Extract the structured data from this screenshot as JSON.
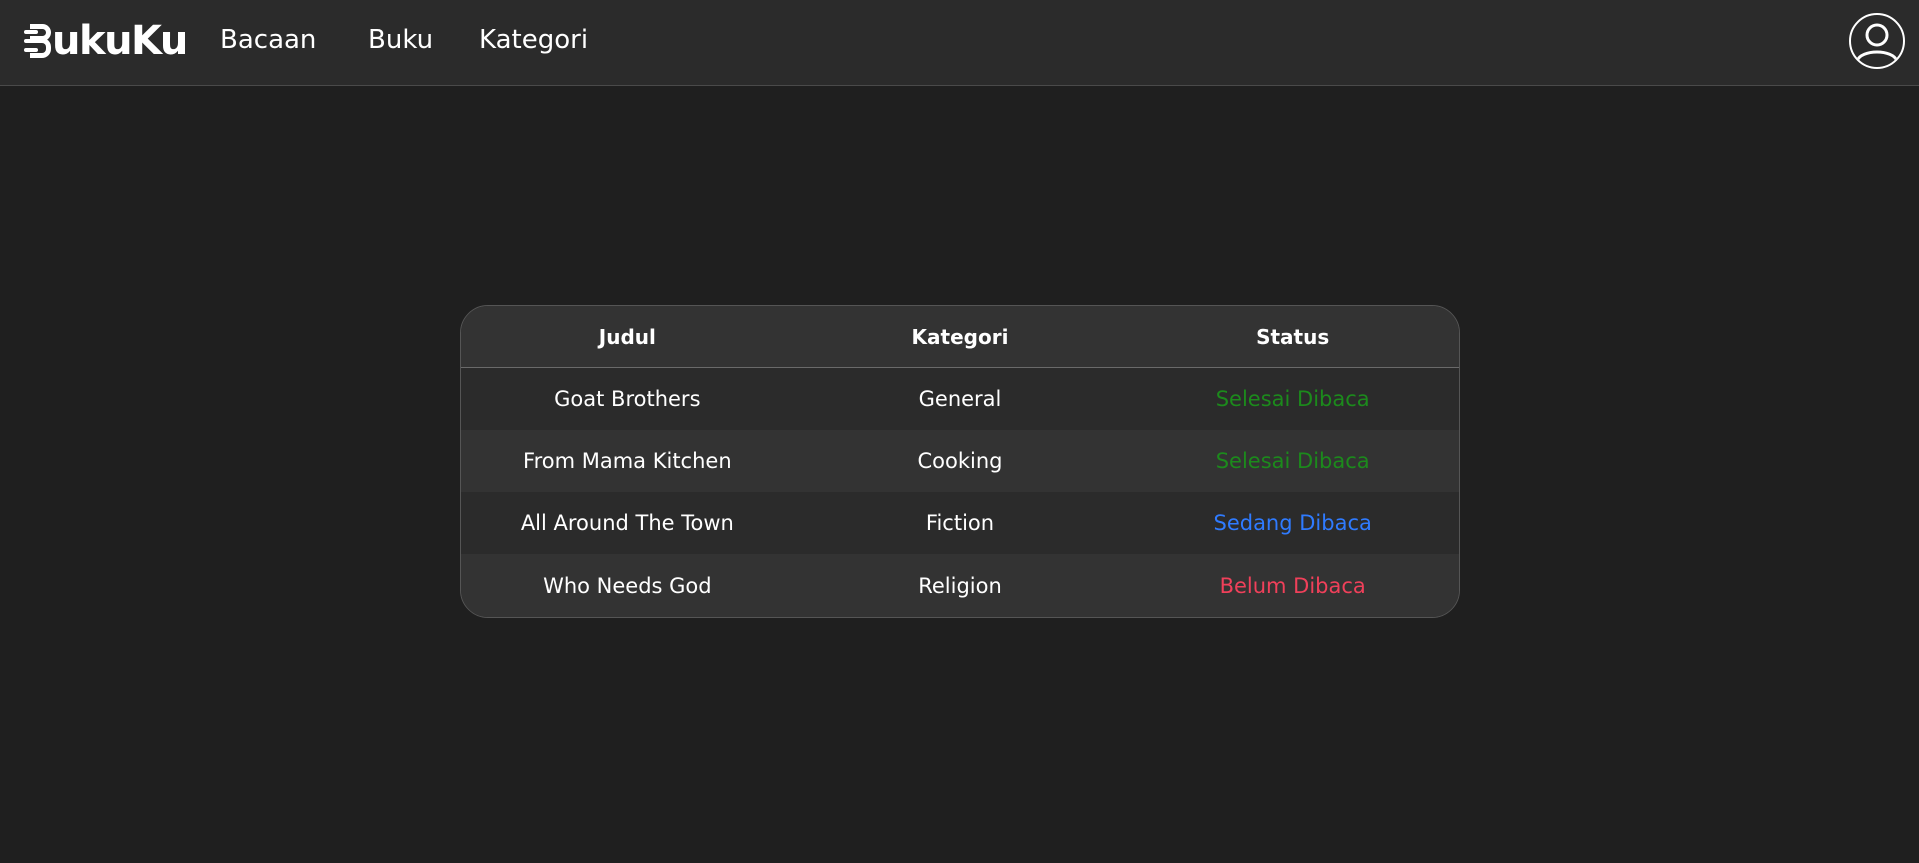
{
  "navbar": {
    "logo_text": "ukuKu",
    "links": [
      {
        "label": "Bacaan"
      },
      {
        "label": "Buku"
      },
      {
        "label": "Kategori"
      }
    ],
    "avatar_icon": "user-circle-icon"
  },
  "table": {
    "headers": [
      "Judul",
      "Kategori",
      "Status"
    ],
    "rows": [
      {
        "judul": "Goat Brothers",
        "kategori": "General",
        "status": "Selesai Dibaca",
        "status_color": "#1c8a1c"
      },
      {
        "judul": "From Mama Kitchen",
        "kategori": "Cooking",
        "status": "Selesai Dibaca",
        "status_color": "#1c8a1c"
      },
      {
        "judul": "All Around The Town",
        "kategori": "Fiction",
        "status": "Sedang Dibaca",
        "status_color": "#2f7bff"
      },
      {
        "judul": "Who Needs God",
        "kategori": "Religion",
        "status": "Belum Dibaca",
        "status_color": "#f0405a"
      }
    ]
  },
  "colors": {
    "background": "#1f1f1f",
    "navbar": "#2b2b2b",
    "status_done": "#1c8a1c",
    "status_reading": "#2f7bff",
    "status_unread": "#f0405a"
  }
}
